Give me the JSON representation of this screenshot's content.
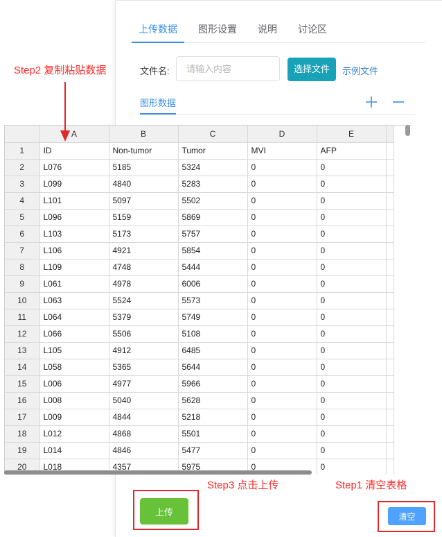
{
  "tabs": [
    "上传数据",
    "图形设置",
    "说明",
    "讨论区"
  ],
  "file": {
    "label": "文件名:",
    "placeholder": "请输入内容",
    "choose_label": "选择文件",
    "example_label": "示例文件"
  },
  "subtab": "图形数据",
  "annotations": {
    "step1": "Step1 清空表格",
    "step2": "Step2 复制粘贴数据",
    "step3": "Step3 点击上传"
  },
  "buttons": {
    "upload": "上传",
    "clear": "清空"
  },
  "sheet": {
    "columns": [
      "A",
      "B",
      "C",
      "D",
      "E"
    ],
    "rows": [
      [
        "1",
        "ID",
        "Non-tumor",
        "Tumor",
        "MVI",
        "AFP"
      ],
      [
        "2",
        "L076",
        "5185",
        "5324",
        "0",
        "0"
      ],
      [
        "3",
        "L099",
        "4840",
        "5283",
        "0",
        "0"
      ],
      [
        "4",
        "L101",
        "5097",
        "5502",
        "0",
        "0"
      ],
      [
        "5",
        "L096",
        "5159",
        "5869",
        "0",
        "0"
      ],
      [
        "6",
        "L103",
        "5173",
        "5757",
        "0",
        "0"
      ],
      [
        "7",
        "L106",
        "4921",
        "5854",
        "0",
        "0"
      ],
      [
        "8",
        "L109",
        "4748",
        "5444",
        "0",
        "0"
      ],
      [
        "9",
        "L061",
        "4978",
        "6006",
        "0",
        "0"
      ],
      [
        "10",
        "L063",
        "5524",
        "5573",
        "0",
        "0"
      ],
      [
        "11",
        "L064",
        "5379",
        "5749",
        "0",
        "0"
      ],
      [
        "12",
        "L066",
        "5506",
        "5108",
        "0",
        "0"
      ],
      [
        "13",
        "L105",
        "4912",
        "6485",
        "0",
        "0"
      ],
      [
        "14",
        "L058",
        "5365",
        "5644",
        "0",
        "0"
      ],
      [
        "15",
        "L006",
        "4977",
        "5966",
        "0",
        "0"
      ],
      [
        "16",
        "L008",
        "5040",
        "5628",
        "0",
        "0"
      ],
      [
        "17",
        "L009",
        "4844",
        "5218",
        "0",
        "0"
      ],
      [
        "18",
        "L012",
        "4868",
        "5501",
        "0",
        "0"
      ],
      [
        "19",
        "L014",
        "4846",
        "5477",
        "0",
        "0"
      ],
      [
        "20",
        "L018",
        "4357",
        "5975",
        "0",
        "0"
      ]
    ]
  },
  "colors": {
    "accent": "#3a8ee6",
    "annotation": "#ff2a2a",
    "upload": "#67c23a",
    "clear": "#4fa2ff",
    "choose": "#17a2b8"
  }
}
